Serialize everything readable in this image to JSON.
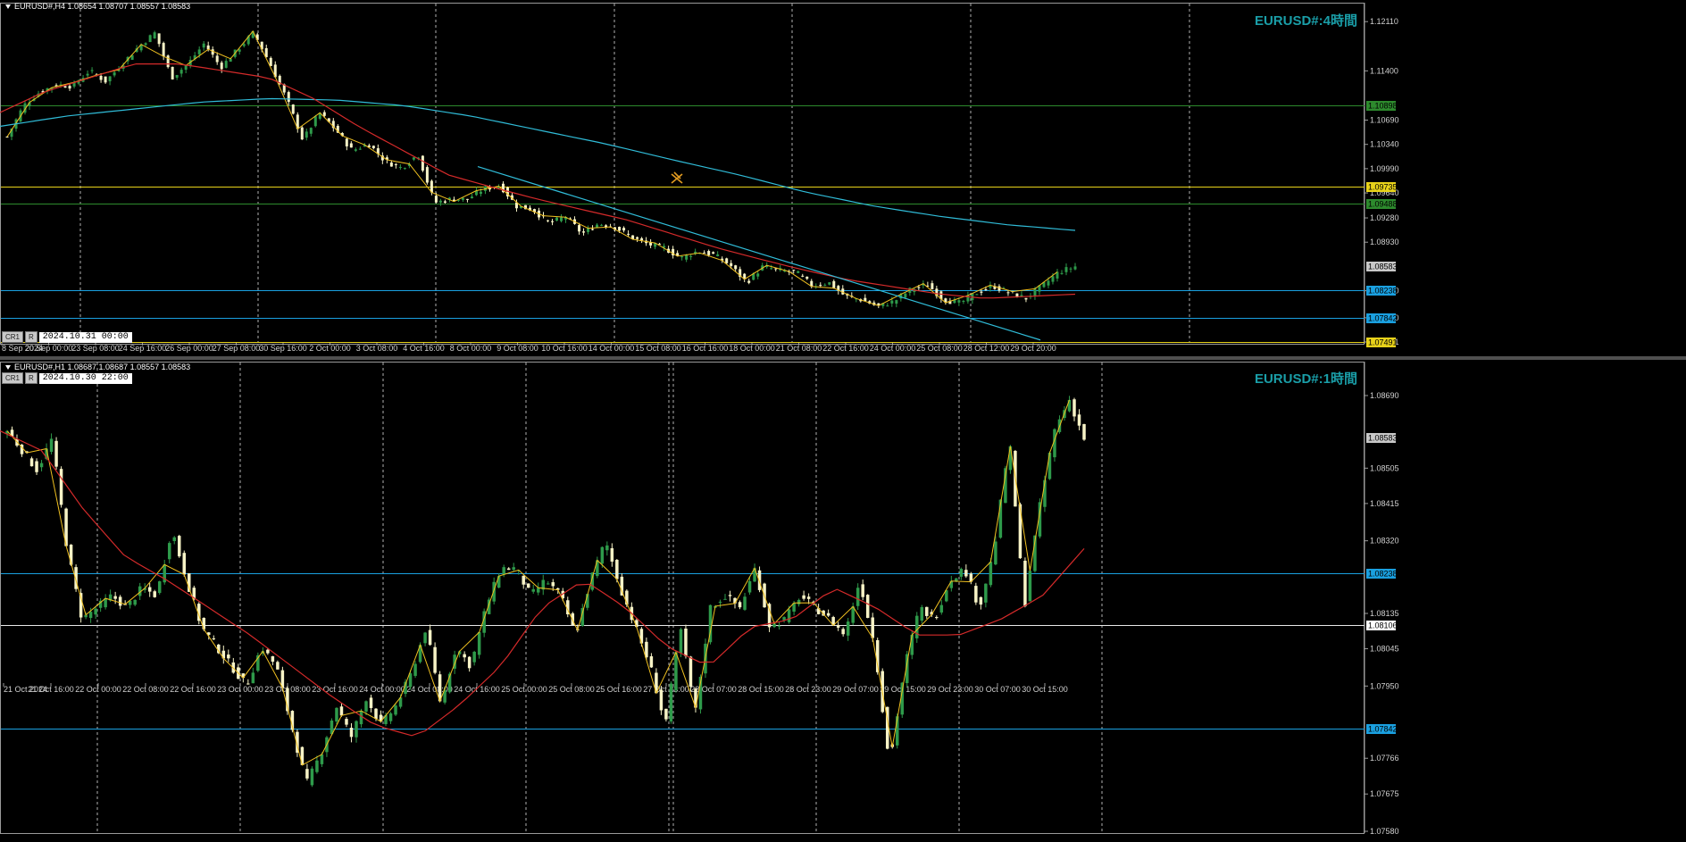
{
  "colors": {
    "background": "#000000",
    "grid": "#b0b0b0",
    "candle_up": "#2e9a4a",
    "candle_down": "#f7f3c6",
    "zigzag": "#f0c020",
    "ma_red": "#d42a2a",
    "ma_cyan": "#30bcd8",
    "hline_blue": "#1aa0e0",
    "hline_yellow": "#e8d21a",
    "hline_green": "#2d8a2d",
    "hline_white": "#e8e8e8",
    "watermark": "#1a9ea8",
    "price_tag_current": "#c8c8c8"
  },
  "top": {
    "header": "EURUSD#,H4  1.08654 1.08707 1.08557 1.08583",
    "watermark": "EURUSD#:4時間",
    "crosshair_buttons": [
      "CR1",
      "R"
    ],
    "crosshair_date": "2024.10.31 00:00",
    "price_labels": [
      "1.12110",
      "1.11400",
      "1.10690",
      "1.10340",
      "1.09990",
      "1.09640",
      "1.09280",
      "1.08930",
      "1.08230",
      "1.07840",
      "1.07491"
    ],
    "price_axis": {
      "min": 1.07491,
      "max": 1.1219
    },
    "time_labels": [
      "8 Sep 2024",
      "20 Sep 00:00",
      "23 Sep 08:00",
      "24 Sep 16:00",
      "26 Sep 00:00",
      "27 Sep 08:00",
      "30 Sep 16:00",
      "2 Oct 00:00",
      "3 Oct 08:00",
      "4 Oct 16:00",
      "8 Oct 00:00",
      "9 Oct 08:00",
      "10 Oct 16:00",
      "14 Oct 00:00",
      "15 Oct 08:00",
      "16 Oct 16:00",
      "18 Oct 00:00",
      "21 Oct 08:00",
      "22 Oct 16:00",
      "24 Oct 00:00",
      "25 Oct 08:00",
      "28 Oct 12:00",
      "29 Oct 20:00"
    ],
    "hlines": [
      {
        "price": 1.10898,
        "color": "green",
        "label": "1.10898"
      },
      {
        "price": 1.09735,
        "color": "yellow",
        "label": "1.09735"
      },
      {
        "price": 1.09488,
        "color": "green",
        "label": "1.09488"
      },
      {
        "price": 1.08238,
        "color": "blue",
        "label": "1.08238"
      },
      {
        "price": 1.07842,
        "color": "blue",
        "label": "1.07842"
      },
      {
        "price": 1.07491,
        "color": "yellow",
        "label": "1.07491"
      }
    ],
    "current_price": {
      "price": 1.08583,
      "label": "1.08583"
    },
    "trendline": {
      "start": [
        0.343,
        1.1002
      ],
      "end": [
        0.745,
        1.0752
      ]
    },
    "chart_data": {
      "type": "candlestick",
      "symbol": "EURUSD#",
      "timeframe": "H4",
      "close_path": [
        1.1045,
        1.109,
        1.111,
        1.112,
        1.1118,
        1.114,
        1.1125,
        1.115,
        1.1175,
        1.1195,
        1.113,
        1.115,
        1.118,
        1.1145,
        1.117,
        1.1195,
        1.115,
        1.11,
        1.104,
        1.108,
        1.1055,
        1.1025,
        1.1035,
        1.101,
        1.1,
        1.102,
        1.095,
        1.0955,
        1.0955,
        1.097,
        1.0975,
        1.0945,
        1.094,
        1.092,
        1.093,
        1.0905,
        1.092,
        1.0915,
        1.09,
        1.089,
        1.0885,
        1.087,
        1.088,
        1.0875,
        1.086,
        1.0835,
        1.0858,
        1.0852,
        1.085,
        1.083,
        1.0835,
        1.0815,
        1.081,
        1.08,
        1.0808,
        1.0825,
        1.0832,
        1.081,
        1.0805,
        1.082,
        1.083,
        1.082,
        1.0812,
        1.083,
        1.085,
        1.0858
      ],
      "ma_red": [
        1.108,
        1.111,
        1.113,
        1.115,
        1.115,
        1.114,
        1.113,
        1.11,
        1.106,
        1.1025,
        1.099,
        1.0972,
        1.0955,
        1.094,
        1.0925,
        1.0905,
        1.0885,
        1.0868,
        1.0852,
        1.0838,
        1.0828,
        1.0818,
        1.0812,
        1.0815,
        1.0818
      ],
      "ma_cyan": [
        1.106,
        1.1075,
        1.1085,
        1.1095,
        1.11,
        1.1098,
        1.109,
        1.1075,
        1.1055,
        1.1035,
        1.1012,
        1.099,
        1.0965,
        1.0945,
        1.093,
        1.0918,
        1.091
      ]
    }
  },
  "bottom": {
    "header": "EURUSD#,H1  1.08687 1.08687 1.08557 1.08583",
    "watermark": "EURUSD#:1時間",
    "crosshair_buttons": [
      "CR1",
      "R"
    ],
    "crosshair_date": "2024.10.30 22:00",
    "price_labels": [
      "1.08690",
      "1.08505",
      "1.08415",
      "1.08320",
      "1.08135",
      "1.08045",
      "1.07950",
      "1.07766",
      "1.07675",
      "1.07580"
    ],
    "price_axis": {
      "min": 1.0758,
      "max": 1.0874
    },
    "time_labels": [
      "21 Oct 2024",
      "21 Oct 16:00",
      "22 Oct 00:00",
      "22 Oct 08:00",
      "22 Oct 16:00",
      "23 Oct 00:00",
      "23 Oct 08:00",
      "23 Oct 16:00",
      "24 Oct 00:00",
      "24 Oct 08:00",
      "24 Oct 16:00",
      "25 Oct 00:00",
      "25 Oct 08:00",
      "25 Oct 16:00",
      "27 Oct 23:00",
      "28 Oct 07:00",
      "28 Oct 15:00",
      "28 Oct 23:00",
      "29 Oct 07:00",
      "29 Oct 15:00",
      "29 Oct 23:00",
      "30 Oct 07:00",
      "30 Oct 15:00"
    ],
    "hlines": [
      {
        "price": 1.08238,
        "color": "blue",
        "label": "1.08238"
      },
      {
        "price": 1.08106,
        "color": "white",
        "label": "1.08106"
      },
      {
        "price": 1.07842,
        "color": "blue",
        "label": "1.07842"
      }
    ],
    "current_price": {
      "price": 1.08583,
      "label": "1.08583"
    },
    "chart_data": {
      "type": "candlestick",
      "symbol": "EURUSD#",
      "timeframe": "H1",
      "close_path": [
        1.086,
        1.0855,
        1.085,
        1.0858,
        1.083,
        1.0812,
        1.0815,
        1.0818,
        1.0815,
        1.082,
        1.0818,
        1.0835,
        1.0822,
        1.081,
        1.0805,
        1.08,
        1.0795,
        1.0805,
        1.08,
        1.0785,
        1.077,
        1.0778,
        1.079,
        1.0782,
        1.0792,
        1.0785,
        1.079,
        1.0798,
        1.081,
        1.079,
        1.0805,
        1.08,
        1.0815,
        1.0825,
        1.0825,
        1.0818,
        1.0822,
        1.0818,
        1.0808,
        1.0822,
        1.0832,
        1.082,
        1.081,
        1.08,
        1.0785,
        1.081,
        1.0788,
        1.0815,
        1.0818,
        1.0815,
        1.0825,
        1.081,
        1.0812,
        1.0818,
        1.0815,
        1.0812,
        1.0808,
        1.0822,
        1.0805,
        1.0775,
        1.08,
        1.0815,
        1.0812,
        1.0822,
        1.0825,
        1.0815,
        1.083,
        1.0858,
        1.0815,
        1.084,
        1.086,
        1.0868,
        1.0858
      ],
      "ma_red": [
        1.086,
        1.0855,
        1.084,
        1.0828,
        1.0822,
        1.0815,
        1.0808,
        1.08,
        1.0792,
        1.0785,
        1.0782,
        1.079,
        1.08,
        1.0815,
        1.0822,
        1.0815,
        1.0805,
        1.08,
        1.081,
        1.0812,
        1.082,
        1.0815,
        1.0808,
        1.0808,
        1.0812,
        1.0818,
        1.083
      ]
    }
  }
}
